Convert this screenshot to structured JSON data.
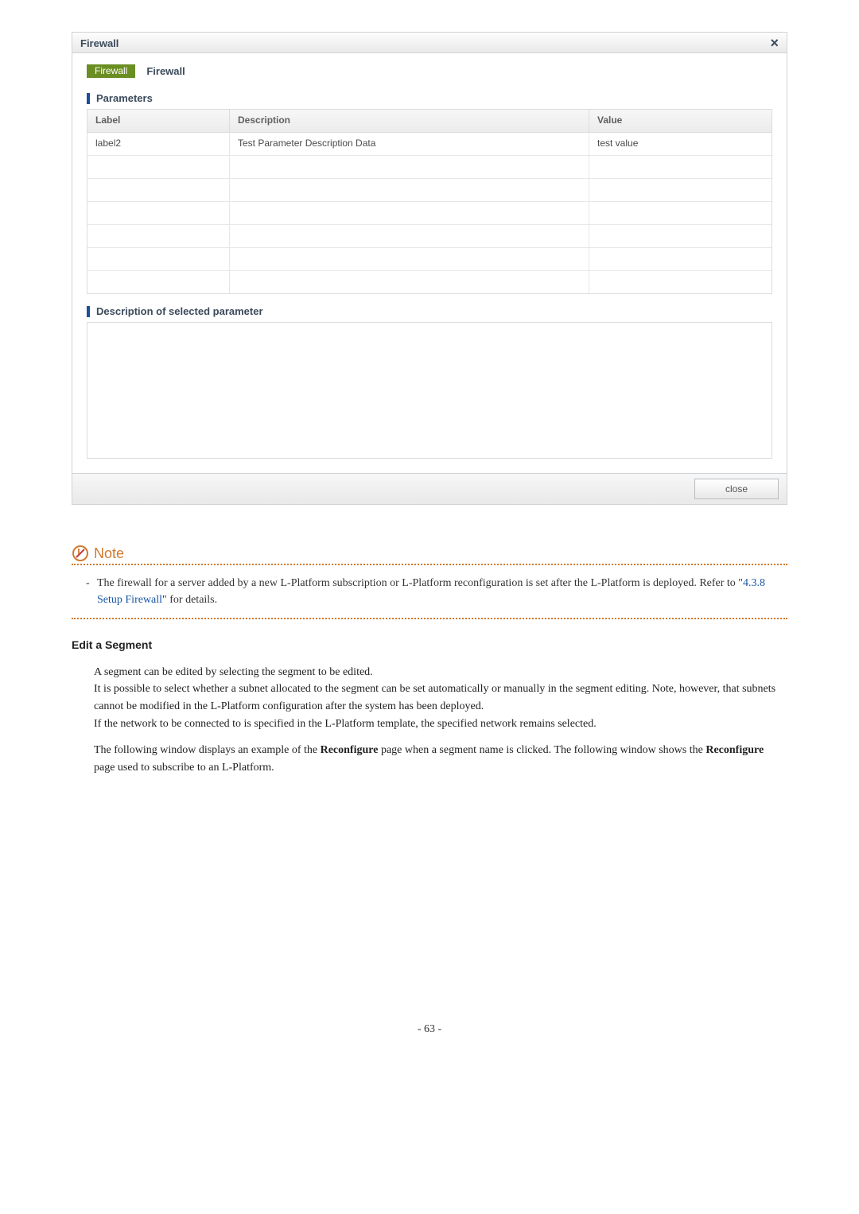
{
  "dialog": {
    "title": "Firewall",
    "tag_chip": "Firewall",
    "tag_label": "Firewall",
    "sections": {
      "parameters": "Parameters",
      "desc_param": "Description of selected parameter"
    },
    "table": {
      "headers": {
        "label": "Label",
        "description": "Description",
        "value": "Value"
      },
      "rows": [
        {
          "label": "label2",
          "description": "Test Parameter Description Data",
          "value": "test value"
        },
        {
          "label": "",
          "description": "",
          "value": ""
        },
        {
          "label": "",
          "description": "",
          "value": ""
        },
        {
          "label": "",
          "description": "",
          "value": ""
        },
        {
          "label": "",
          "description": "",
          "value": ""
        },
        {
          "label": "",
          "description": "",
          "value": ""
        },
        {
          "label": "",
          "description": "",
          "value": ""
        }
      ]
    },
    "close_button": "close",
    "close_x": "×"
  },
  "note": {
    "heading": "Note",
    "line1a": "The firewall for a server added by a new L-Platform subscription or L-Platform reconfiguration is set after the L-Platform is deployed. Refer to \"",
    "link": "4.3.8 Setup Firewall",
    "line1b": "\" for details."
  },
  "section": {
    "heading": "Edit a Segment",
    "p1": "A segment can be edited by selecting the segment to be edited.",
    "p2": "It is possible to select whether a subnet allocated to the segment can be set automatically or manually in the segment editing. Note, however, that subnets cannot be modified in the L-Platform configuration after the system has been deployed.",
    "p3": "If the network to be connected to is specified in the L-Platform template, the specified network remains selected.",
    "p4a": "The following window displays an example of the ",
    "p4b": "Reconfigure",
    "p4c": " page when a segment name is clicked. The following window shows the ",
    "p4d": "Reconfigure",
    "p4e": " page used to subscribe to an L-Platform."
  },
  "page_number": "- 63 -"
}
